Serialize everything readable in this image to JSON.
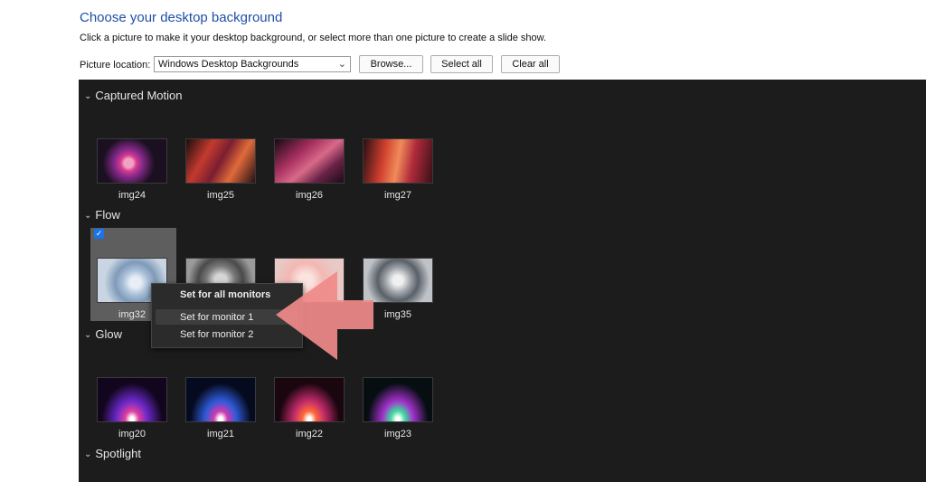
{
  "header": {
    "title": "Choose your desktop background",
    "subtitle": "Click a picture to make it your desktop background, or select more than one picture to create a slide show."
  },
  "location": {
    "label": "Picture location:",
    "selected": "Windows Desktop Backgrounds",
    "browse_label": "Browse...",
    "select_all_label": "Select all",
    "clear_all_label": "Clear all"
  },
  "groups": [
    {
      "name": "Captured Motion",
      "images": [
        "img24",
        "img25",
        "img26",
        "img27"
      ]
    },
    {
      "name": "Flow",
      "images": [
        "img32",
        "img35"
      ]
    },
    {
      "name": "Glow",
      "images": [
        "img20",
        "img21",
        "img22",
        "img23"
      ]
    },
    {
      "name": "Spotlight",
      "images": []
    }
  ],
  "context_menu": {
    "items": [
      "Set for all monitors",
      "Set for monitor 1",
      "Set for monitor 2"
    ],
    "highlighted_index": 1
  },
  "colors": {
    "title": "#1e4fa8",
    "panel_bg": "#1c1c1c",
    "check_accent": "#1a73e8",
    "arrow": "#f08a8a"
  },
  "icons": [
    "chevron-down-icon",
    "checkmark-icon",
    "arrow-annotation"
  ]
}
